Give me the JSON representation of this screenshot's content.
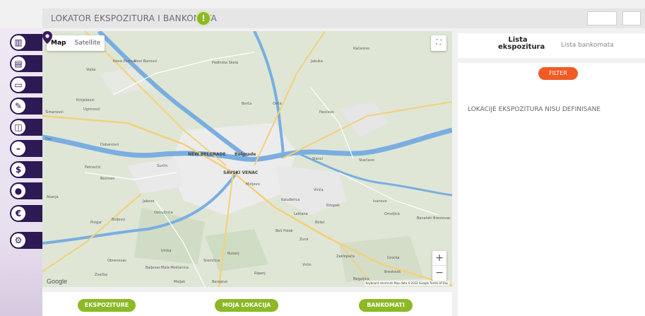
{
  "header": {
    "title": "LOKATOR EKSPOZITURA I BANKOMATA",
    "info_icon": "info-icon",
    "info_symbol": "!"
  },
  "sidebar": {
    "items": [
      {
        "name": "chart-icon",
        "glyph": "▥"
      },
      {
        "name": "document-icon",
        "glyph": "▤"
      },
      {
        "name": "card-icon",
        "glyph": "▭"
      },
      {
        "name": "signature-icon",
        "glyph": "✎"
      },
      {
        "name": "money-icon",
        "glyph": "◫"
      },
      {
        "name": "minus-icon",
        "glyph": "–"
      },
      {
        "name": "dollar-coin-icon",
        "glyph": "$"
      },
      {
        "name": "location-pin-icon",
        "glyph": "●"
      },
      {
        "name": "euro-icon",
        "glyph": "€"
      },
      {
        "name": "settings-icon",
        "glyph": "⚙"
      }
    ]
  },
  "map": {
    "type_options": [
      "Map",
      "Satellite"
    ],
    "selected_type": "Map",
    "zoom_in": "+",
    "zoom_out": "−",
    "fullscreen_glyph": "⛶",
    "logo": "Google",
    "attribution": "Keyboard shortcuts   Map data ©2022 Google   Terms of Use",
    "labels": [
      {
        "text": "Novi Banovci",
        "k": "a"
      },
      {
        "text": "Vojka",
        "k": "b"
      },
      {
        "text": "Nova Pazova",
        "k": "c"
      },
      {
        "text": "Krnješevci",
        "k": "d"
      },
      {
        "text": "Ugrinovci",
        "k": "e"
      },
      {
        "text": "Šimanovci",
        "k": "f"
      },
      {
        "text": "Dec",
        "k": "g"
      },
      {
        "text": "Dobanovci",
        "k": "h"
      },
      {
        "text": "Surčin",
        "k": "i"
      },
      {
        "text": "Petrovčić",
        "k": "j"
      },
      {
        "text": "Bečmen",
        "k": "k"
      },
      {
        "text": "NEW BELGRADE",
        "k": "l",
        "big": true
      },
      {
        "text": "Belgrade",
        "k": "m",
        "big": true
      },
      {
        "text": "SAVSKI VENAC",
        "k": "n",
        "big": true
      },
      {
        "text": "Borča",
        "k": "o"
      },
      {
        "text": "Ovča",
        "k": "p"
      },
      {
        "text": "Padinska Skela",
        "k": "q"
      },
      {
        "text": "Jabuka",
        "k": "r"
      },
      {
        "text": "Kačarevo",
        "k": "s"
      },
      {
        "text": "Pančevo",
        "k": "t"
      },
      {
        "text": "Starčevo",
        "k": "u"
      },
      {
        "text": "Slanci",
        "k": "v"
      },
      {
        "text": "Vinča",
        "k": "w"
      },
      {
        "text": "Mirijevo",
        "k": "x"
      },
      {
        "text": "Kaluđerica",
        "k": "y"
      },
      {
        "text": "Leštane",
        "k": "z"
      },
      {
        "text": "Ritopek",
        "k": "aa"
      },
      {
        "text": "Boleč",
        "k": "bb"
      },
      {
        "text": "Grocka",
        "k": "cc"
      },
      {
        "text": "Zaklopača",
        "k": "dd"
      },
      {
        "text": "Beli Potok",
        "k": "ee"
      },
      {
        "text": "Zuce",
        "k": "ff"
      },
      {
        "text": "Ripanj",
        "k": "gg"
      },
      {
        "text": "Vrčin",
        "k": "hh"
      },
      {
        "text": "Rušanj",
        "k": "ii"
      },
      {
        "text": "Sremčica",
        "k": "jj"
      },
      {
        "text": "Umka",
        "k": "kk"
      },
      {
        "text": "Ostružnica",
        "k": "ll"
      },
      {
        "text": "Barajevo",
        "k": "mm"
      },
      {
        "text": "Progar",
        "k": "nn"
      },
      {
        "text": "Obrenovac",
        "k": "oo"
      },
      {
        "text": "Zvečka",
        "k": "pp"
      },
      {
        "text": "Baljevac",
        "k": "qq"
      },
      {
        "text": "Mala Moštanica",
        "k": "rr"
      },
      {
        "text": "Meljak",
        "k": "ss"
      },
      {
        "text": "Jakovo",
        "k": "tt"
      },
      {
        "text": "Boljevci",
        "k": "uu"
      },
      {
        "text": "Ašanja",
        "k": "vv"
      },
      {
        "text": "Omoljica",
        "k": "ww"
      },
      {
        "text": "Ivanovo",
        "k": "xx"
      },
      {
        "text": "Brestovik",
        "k": "yy"
      },
      {
        "text": "Begaljica",
        "k": "zz"
      },
      {
        "text": "Banatski Brestovac",
        "k": "ab"
      }
    ]
  },
  "bottom": {
    "buttons": [
      "EKSPOZITURE",
      "MOJA LOKACIJA",
      "BANKOMATI"
    ]
  },
  "panel": {
    "tabs": [
      "Lista ekspozitura",
      "Lista bankomata"
    ],
    "active_tab": "Lista ekspozitura",
    "filter_label": "FILTER",
    "empty_message": "LOKACIJE EKSPOZITURA NISU DEFINISANE"
  },
  "colors": {
    "accent_green": "#8cb924",
    "accent_orange": "#f15a24",
    "nav_dark": "#2d1a54",
    "river": "#7aaee0",
    "map_base": "#dfe6d6"
  }
}
